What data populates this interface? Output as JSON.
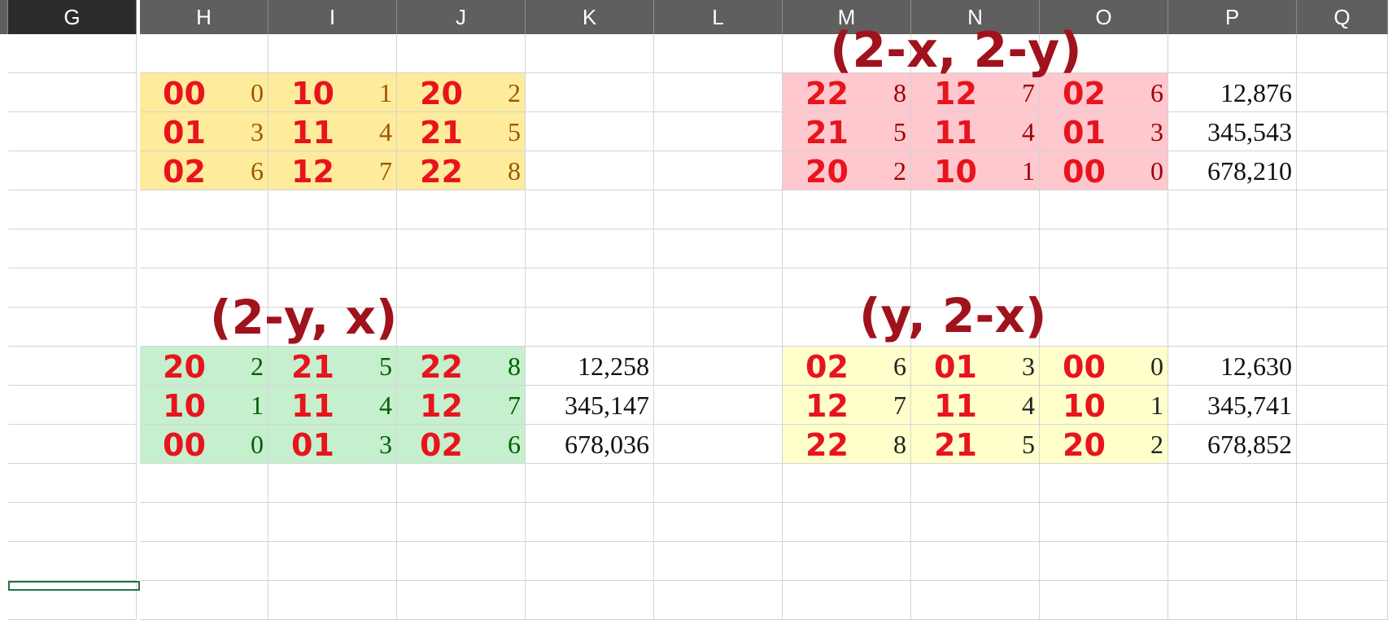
{
  "columns": [
    "G",
    "H",
    "I",
    "J",
    "K",
    "L",
    "M",
    "N",
    "O",
    "P",
    "Q"
  ],
  "colors": {
    "header_bg": "#5f5f5f",
    "selected_header_bg": "#2b2b2b",
    "orange_fill": "#ffeb9c",
    "red_fill": "#ffc7ce",
    "green_fill": "#c6efce",
    "yellow_fill": "#ffffcc",
    "ink_red": "#e8141c",
    "ink_dark_red": "#a0121c"
  },
  "blocks": {
    "top_left": {
      "cells": [
        [
          "0",
          "1",
          "2"
        ],
        [
          "3",
          "4",
          "5"
        ],
        [
          "6",
          "7",
          "8"
        ]
      ],
      "text_color": "#9c5700"
    },
    "top_right": {
      "cells": [
        [
          "8",
          "7",
          "6"
        ],
        [
          "5",
          "4",
          "3"
        ],
        [
          "2",
          "1",
          "0"
        ]
      ],
      "text_color": "#9c0006",
      "sums": [
        "12,876",
        "345,543",
        "678,210"
      ]
    },
    "bottom_left": {
      "cells": [
        [
          "2",
          "5",
          "8"
        ],
        [
          "1",
          "4",
          "7"
        ],
        [
          "0",
          "3",
          "6"
        ]
      ],
      "text_color": "#006100",
      "sums": [
        "12,258",
        "345,147",
        "678,036"
      ]
    },
    "bottom_right": {
      "cells": [
        [
          "6",
          "3",
          "0"
        ],
        [
          "7",
          "4",
          "1"
        ],
        [
          "8",
          "5",
          "2"
        ]
      ],
      "text_color": "#222222",
      "sums": [
        "12,630",
        "345,741",
        "678,852"
      ]
    }
  },
  "annotations": {
    "top_left": [
      [
        "00",
        "10",
        "20"
      ],
      [
        "01",
        "11",
        "21"
      ],
      [
        "02",
        "12",
        "22"
      ]
    ],
    "top_right": [
      [
        "22",
        "12",
        "02"
      ],
      [
        "21",
        "11",
        "01"
      ],
      [
        "20",
        "10",
        "00"
      ]
    ],
    "bottom_left": [
      [
        "20",
        "21",
        "22"
      ],
      [
        "10",
        "11",
        "12"
      ],
      [
        "00",
        "01",
        "02"
      ]
    ],
    "bottom_right": [
      [
        "02",
        "01",
        "00"
      ],
      [
        "12",
        "11",
        "10"
      ],
      [
        "22",
        "21",
        "20"
      ]
    ],
    "formula_top_right": "(2-x, 2-y)",
    "formula_bottom_left": "(2-y, x)",
    "formula_bottom_right": "(y, 2-x)"
  }
}
